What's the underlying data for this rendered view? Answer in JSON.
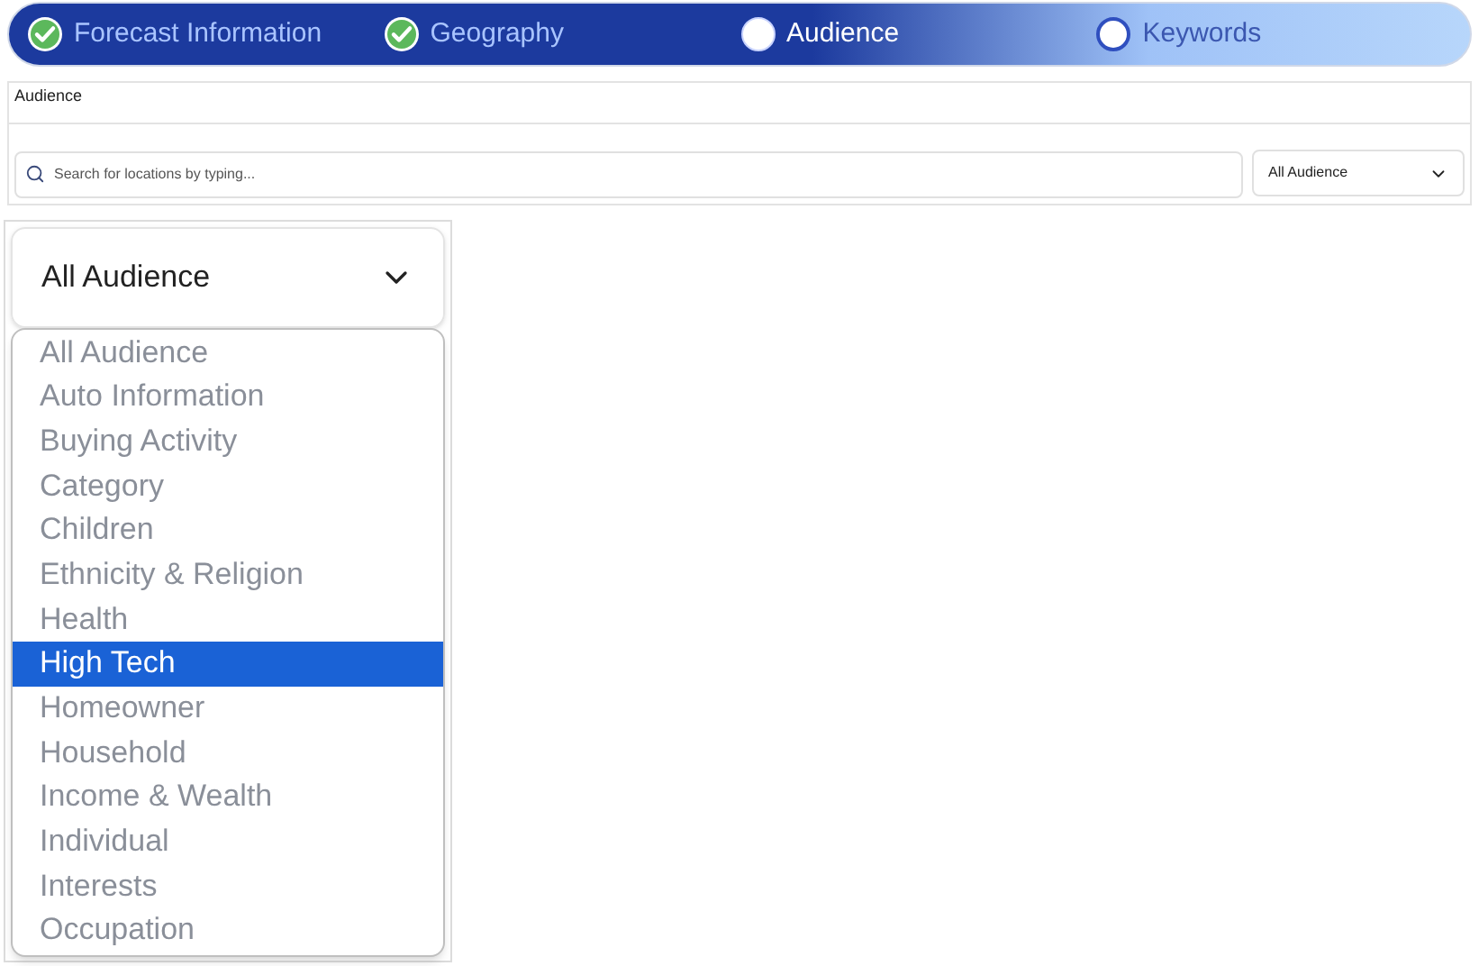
{
  "steps": [
    {
      "label": "Forecast Information",
      "kind": "done"
    },
    {
      "label": "Geography",
      "kind": "done"
    },
    {
      "label": "Audience",
      "kind": "current"
    },
    {
      "label": "Keywords",
      "kind": "todo"
    }
  ],
  "panel": {
    "title": "Audience",
    "search": {
      "placeholder": "Search for locations by typing..."
    },
    "filter": {
      "value": "All Audience"
    }
  },
  "dropdown": {
    "value": "All Audience",
    "options": [
      {
        "label": "All Audience",
        "highlighted": false
      },
      {
        "label": "Auto Information",
        "highlighted": false
      },
      {
        "label": "Buying Activity",
        "highlighted": false
      },
      {
        "label": "Category",
        "highlighted": false
      },
      {
        "label": "Children",
        "highlighted": false
      },
      {
        "label": "Ethnicity & Religion",
        "highlighted": false
      },
      {
        "label": "Health",
        "highlighted": false
      },
      {
        "label": "High Tech",
        "highlighted": true
      },
      {
        "label": "Homeowner",
        "highlighted": false
      },
      {
        "label": "Household",
        "highlighted": false
      },
      {
        "label": "Income & Wealth",
        "highlighted": false
      },
      {
        "label": "Individual",
        "highlighted": false
      },
      {
        "label": "Interests",
        "highlighted": false
      },
      {
        "label": "Occupation",
        "highlighted": false
      }
    ]
  }
}
